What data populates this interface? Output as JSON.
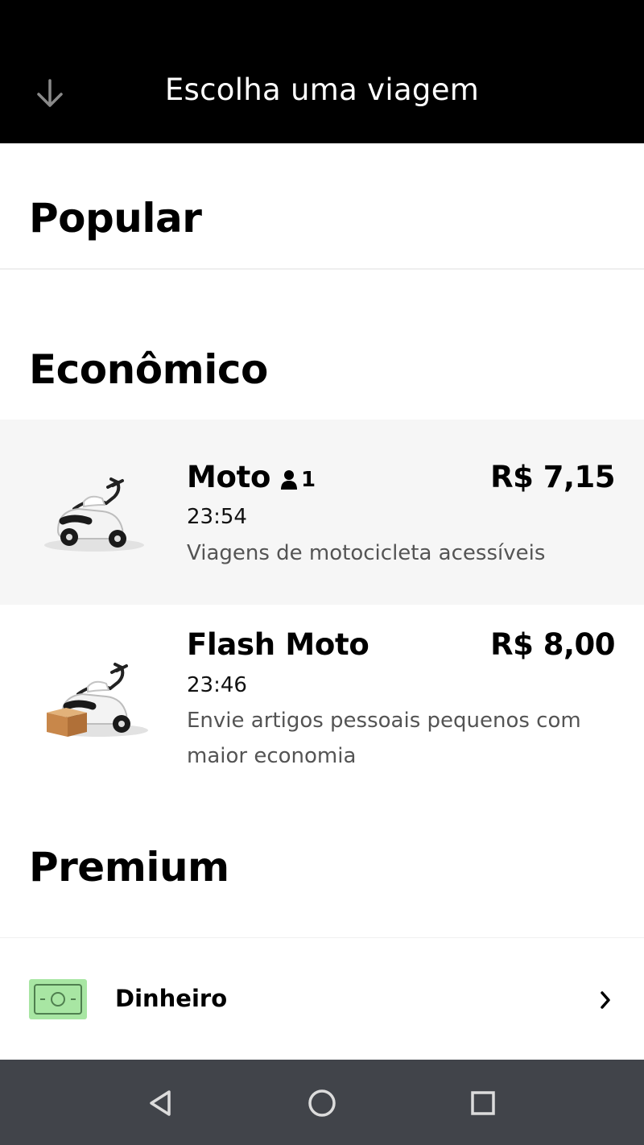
{
  "header": {
    "title": "Escolha uma viagem",
    "back_icon": "arrow-down-icon"
  },
  "sections": {
    "popular": "Popular",
    "economico": "Econômico",
    "premium": "Premium"
  },
  "options": [
    {
      "name": "Moto",
      "passengers": "1",
      "price": "R$ 7,15",
      "time": "23:54",
      "description": "Viagens de motocicleta acessíveis",
      "selected": true,
      "icon": "scooter-icon"
    },
    {
      "name": "Flash Moto",
      "price": "R$ 8,00",
      "time": "23:46",
      "description": "Envie artigos pessoais pequenos com maior economia",
      "selected": false,
      "icon": "scooter-package-icon"
    }
  ],
  "payment": {
    "label": "Dinheiro",
    "icon": "cash-icon",
    "color": "#a8e6a3"
  },
  "system_nav": {
    "back": "nav-back-icon",
    "home": "nav-home-icon",
    "recents": "nav-recents-icon"
  }
}
